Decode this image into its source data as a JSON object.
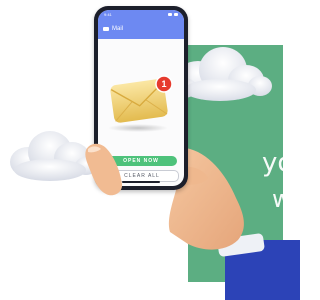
{
  "phone": {
    "status_time": "9:41",
    "app_title": "Mail",
    "badge_count": "1",
    "primary_button": "OPEN NOW",
    "secondary_button": "CLEAR ALL"
  },
  "background": {
    "text_line_1": "yo",
    "text_line_2": "w"
  },
  "colors": {
    "green_panel": "#5cae82",
    "header_blue": "#6d89f2",
    "open_button": "#4ec27b",
    "sleeve_blue": "#2c43b7",
    "badge_red": "#e63b2e"
  },
  "icons": [
    "envelope-icon",
    "notification-badge",
    "mail-icon",
    "cloud"
  ]
}
